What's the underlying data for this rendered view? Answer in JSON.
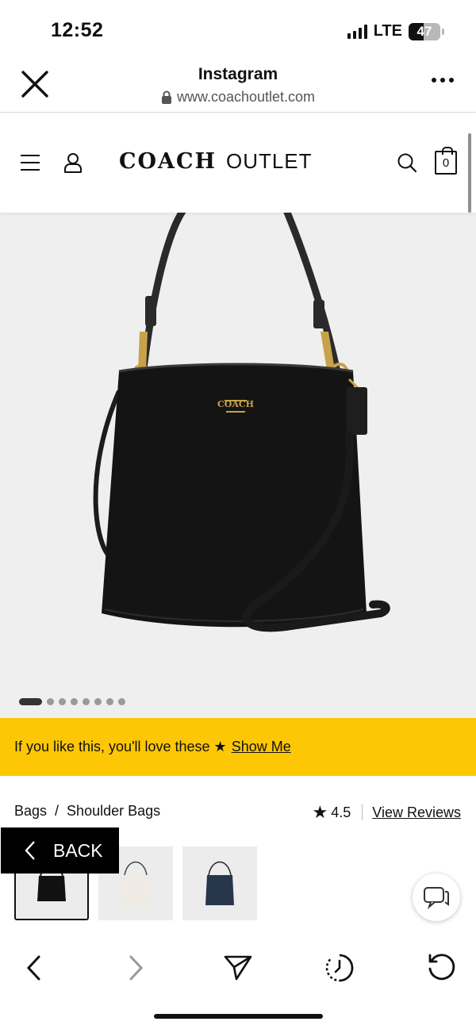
{
  "status_bar": {
    "time": "12:52",
    "network": "LTE",
    "battery": "47",
    "battery_level": 0.47
  },
  "browser": {
    "title": "Instagram",
    "url": "www.coachoutlet.com"
  },
  "site": {
    "brand_name": "COACH",
    "brand_suffix": "OUTLET",
    "bag_count": "0"
  },
  "carousel": {
    "total_slides": 8,
    "active_slide": 1
  },
  "promo": {
    "text": "If you like this, you'll love these ★",
    "link": "Show Me"
  },
  "breadcrumb": {
    "items": [
      "Bags",
      "/",
      "Shoulder Bags"
    ]
  },
  "rating": {
    "value": "4.5",
    "link": "View Reviews"
  },
  "back_button": {
    "label": "BACK"
  },
  "colors": {
    "promo_bg": "#fdc705",
    "bag_black": "#111111",
    "bag_chalk": "#efebe4",
    "bag_navy": "#27364a"
  },
  "swatches": [
    "black",
    "chalk",
    "navy"
  ]
}
